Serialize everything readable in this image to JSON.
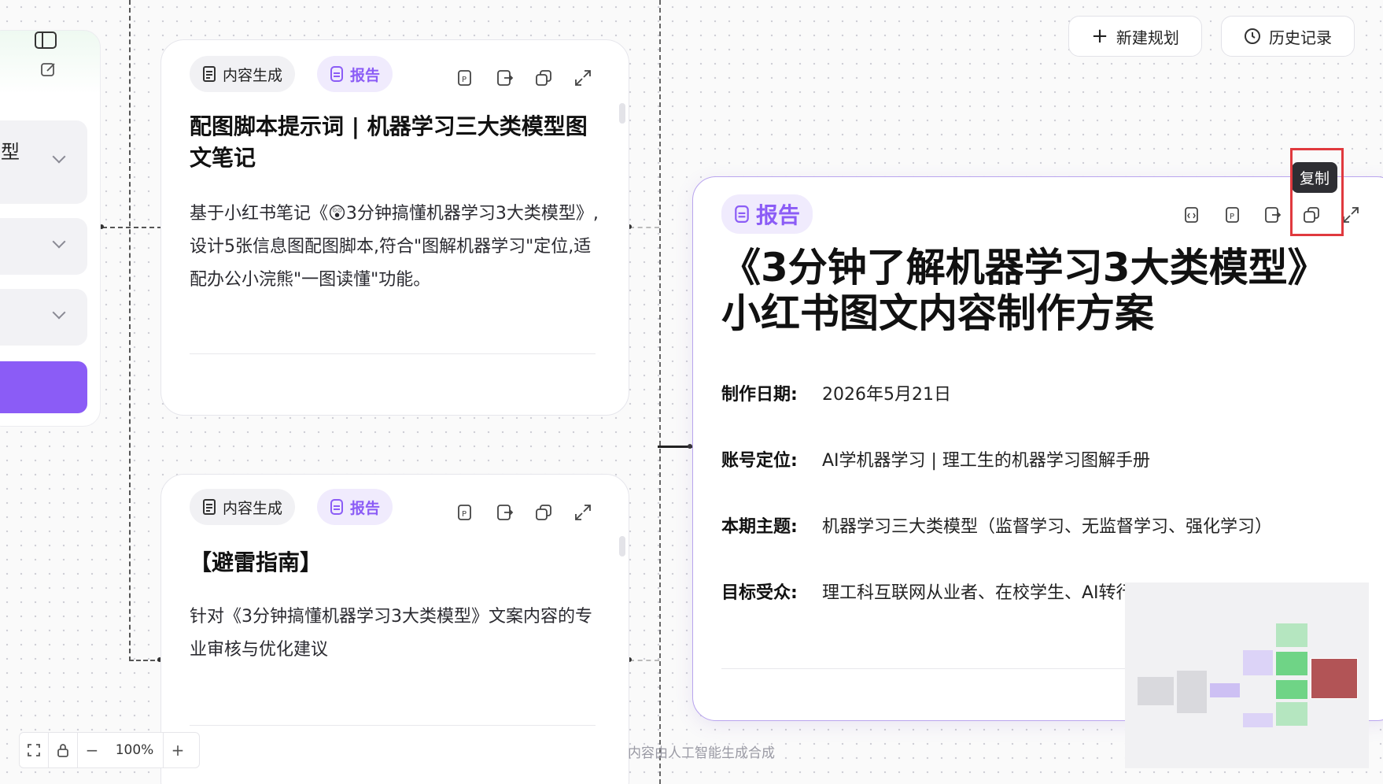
{
  "left_panel": {
    "item_partial_label": "型"
  },
  "cards": [
    {
      "chip_content": "内容生成",
      "chip_report": "报告",
      "title": "配图脚本提示词 | 机器学习三大类模型图文笔记",
      "description": "基于小红书笔记《😲3分钟搞懂机器学习3大类模型》,设计5张信息图配图脚本,符合\"图解机器学习\"定位,适配办公小浣熊\"一图读懂\"功能。"
    },
    {
      "chip_content": "内容生成",
      "chip_report": "报告",
      "title": "【避雷指南】",
      "description": "针对《3分钟搞懂机器学习3大类模型》文案内容的专业审核与优化建议"
    }
  ],
  "report": {
    "chip": "报告",
    "title": "《3分钟了解机器学习3大类模型》小红书图文内容制作方案",
    "fields": [
      {
        "key": "制作日期:",
        "value": "2026年5月21日"
      },
      {
        "key": "账号定位:",
        "value": "AI学机器学习 | 理工生的机器学习图解手册"
      },
      {
        "key": "本期主题:",
        "value": "机器学习三大类模型（监督学习、无监督学习、强化学习）"
      },
      {
        "key": "目标受众:",
        "value": "理工科互联网从业者、在校学生、AI转行者"
      }
    ]
  },
  "top_actions": {
    "new_plan": "新建规划",
    "history": "历史记录"
  },
  "tooltip": "复制",
  "toolbar": {
    "zoom": "100%",
    "minus": "−",
    "plus": "+"
  },
  "footer_note": "内容由人工智能生成合成",
  "colors": {
    "accent": "#8b5cf6",
    "highlight": "#e0393e"
  }
}
